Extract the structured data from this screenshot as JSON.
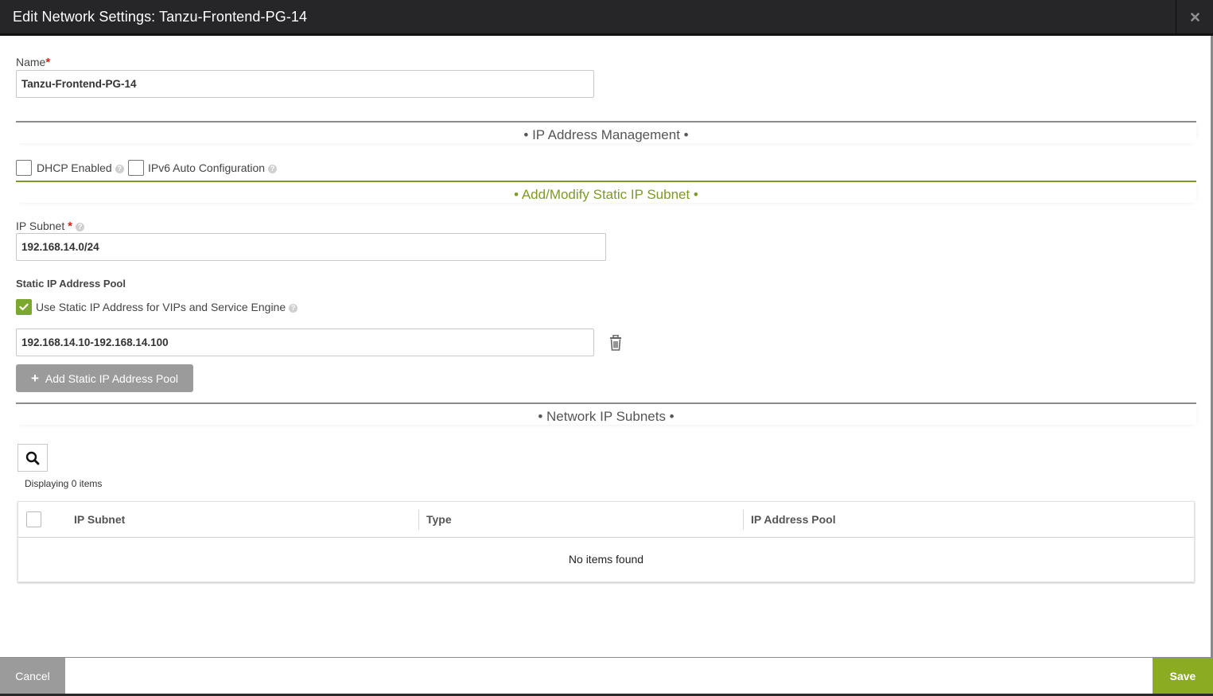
{
  "dialog": {
    "title": "Edit Network Settings: Tanzu-Frontend-PG-14",
    "close_icon": "close-icon"
  },
  "name_field": {
    "label": "Name",
    "required_mark": "*",
    "value": "Tanzu-Frontend-PG-14"
  },
  "ip_management": {
    "section_title": "• IP Address Management •",
    "dhcp": {
      "label": "DHCP Enabled",
      "checked": false,
      "help_icon": "help-icon"
    },
    "ipv6": {
      "label": "IPv6 Auto Configuration",
      "checked": false,
      "help_icon": "help-icon"
    }
  },
  "static_subnet": {
    "section_title": "• Add/Modify Static IP Subnet •",
    "accent_color": "#7d9a26",
    "ip_subnet": {
      "label": "IP Subnet",
      "required_mark": "*",
      "value": "192.168.14.0/24"
    },
    "pool": {
      "title": "Static IP Address Pool",
      "use_static": {
        "label": "Use Static IP Address for VIPs and Service Engine",
        "checked": true
      },
      "ranges": [
        "192.168.14.10-192.168.14.100"
      ],
      "delete_icon": "trash-icon",
      "add_button": "Add Static IP Address Pool"
    }
  },
  "network_subnets": {
    "section_title": "• Network IP Subnets •",
    "search_icon": "search-icon",
    "display_count": "Displaying 0 items",
    "columns": [
      "IP Subnet",
      "Type",
      "IP Address Pool"
    ],
    "rows": [],
    "empty_message": "No items found"
  },
  "footer": {
    "cancel_label": "Cancel",
    "save_label": "Save",
    "save_color": "#8aab22"
  }
}
